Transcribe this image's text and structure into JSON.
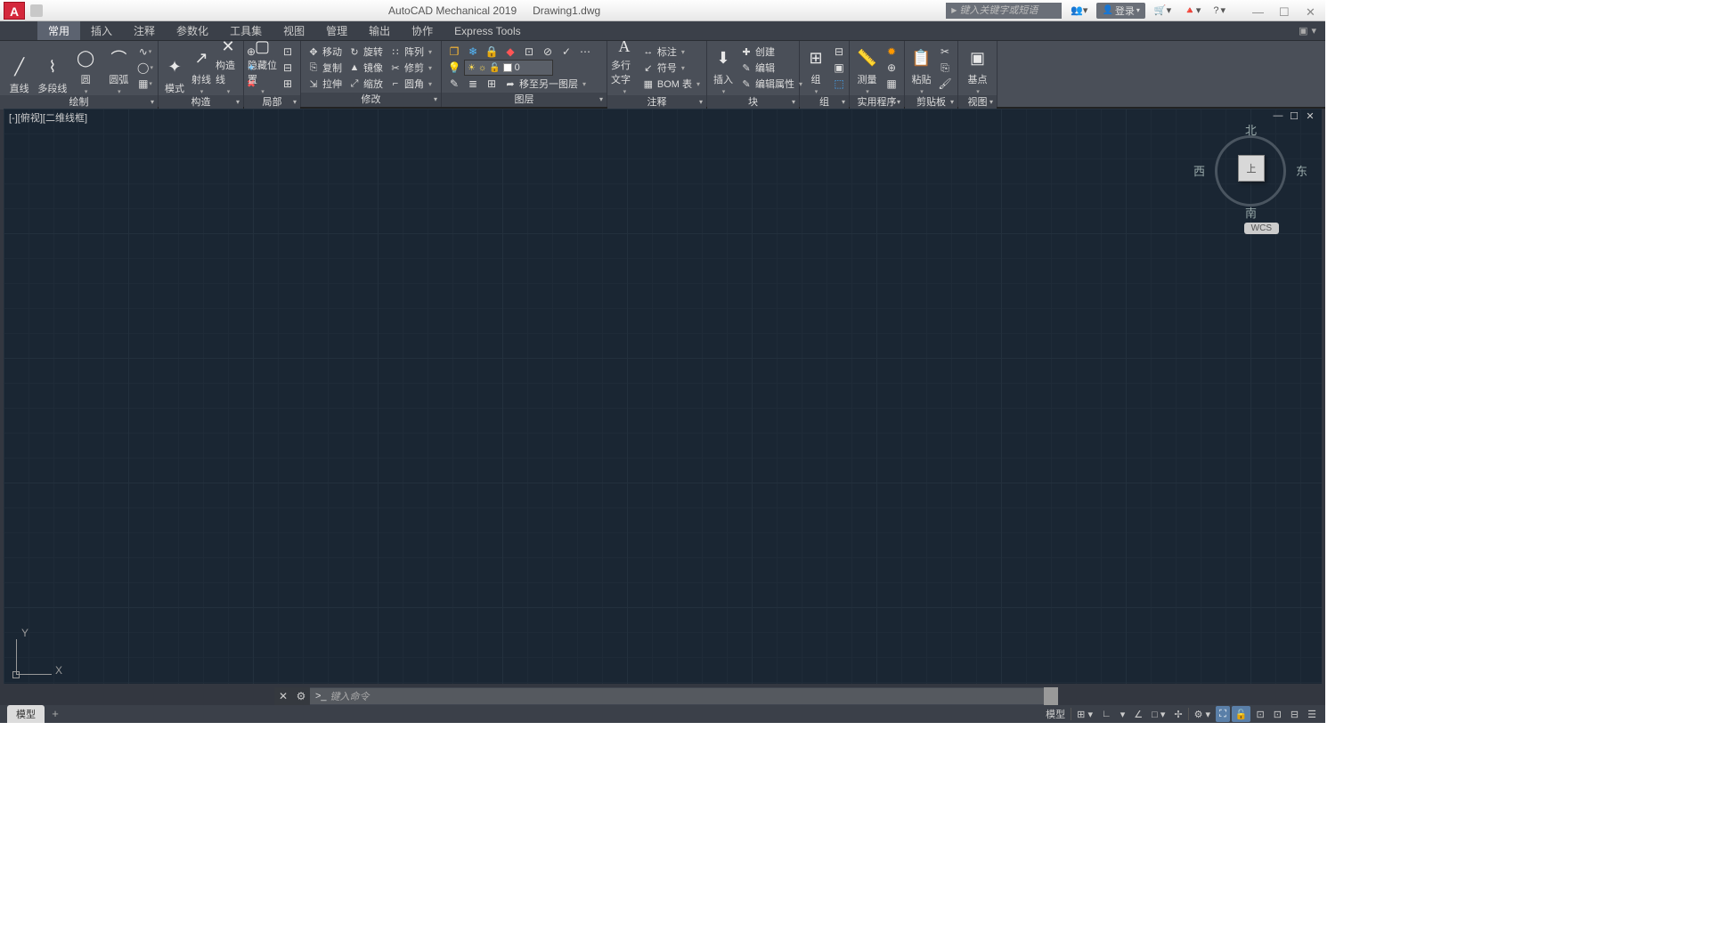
{
  "titlebar": {
    "app_title": "AutoCAD Mechanical 2019",
    "file_name": "Drawing1.dwg",
    "search_placeholder": "键入关键字或短语",
    "login_label": "登录",
    "help_glyph": "?"
  },
  "tabs": {
    "items": [
      "常用",
      "插入",
      "注释",
      "参数化",
      "工具集",
      "视图",
      "管理",
      "输出",
      "协作",
      "Express Tools"
    ],
    "active_index": 0
  },
  "ribbon": {
    "draw": {
      "title": "绘制",
      "line": "直线",
      "polyline": "多段线",
      "circle": "圆",
      "arc": "圆弧"
    },
    "construct": {
      "title": "构造",
      "ray": "射线",
      "construct_line": "构造线",
      "mode": "模式"
    },
    "partial": {
      "title": "局部",
      "hide_pos": "隐藏位置"
    },
    "modify": {
      "title": "修改",
      "move": "移动",
      "copy": "复制",
      "stretch": "拉伸",
      "rotate": "旋转",
      "mirror": "镜像",
      "scale": "缩放",
      "array": "阵列",
      "trim": "修剪",
      "fillet": "圆角"
    },
    "layer": {
      "title": "图层",
      "current": "0",
      "moveto": "移至另一图层"
    },
    "annotate": {
      "title": "注释",
      "mtext": "多行文字",
      "dim": "标注",
      "leader": "符号",
      "bom": "BOM 表"
    },
    "block": {
      "title": "块",
      "insert": "插入",
      "create": "创建",
      "edit": "编辑",
      "attr": "编辑属性"
    },
    "group": {
      "title": "组",
      "label": "组"
    },
    "util": {
      "title": "实用程序",
      "measure": "测量"
    },
    "clipboard": {
      "title": "剪贴板",
      "paste": "粘贴"
    },
    "view": {
      "title": "视图",
      "base": "基点"
    }
  },
  "canvas": {
    "view_label": "[-][俯视][二维线框]",
    "ucs_x": "X",
    "ucs_y": "Y",
    "viewcube_top": "上",
    "dirs": {
      "n": "北",
      "s": "南",
      "e": "东",
      "w": "西"
    },
    "wcs": "WCS"
  },
  "cmdline": {
    "placeholder": "键入命令",
    "prompt": ">_"
  },
  "bottom": {
    "tab_model": "模型",
    "model_btn": "模型"
  }
}
